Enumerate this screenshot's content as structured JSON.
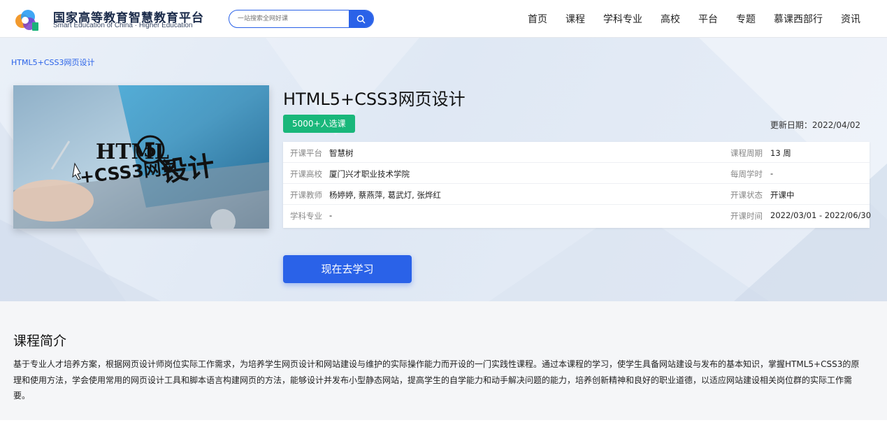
{
  "header": {
    "logo_title": "国家高等教育智慧教育平台",
    "logo_subtitle": "Smart Education of China · Higher Education",
    "search_placeholder": "一站搜索全网好课",
    "nav": [
      "首页",
      "课程",
      "学科专业",
      "高校",
      "平台",
      "专题",
      "慕课西部行",
      "资讯"
    ]
  },
  "breadcrumb": "HTML5+CSS3网页设计",
  "course": {
    "title": "HTML5+CSS3网页设计",
    "badge": "5000+人选课",
    "update_date": "更新日期：2022/04/02",
    "thumbnail_text": {
      "line1": "HTML",
      "circle": "5",
      "line2": "+CSS3网页",
      "big": "设计"
    },
    "info": [
      {
        "label": "开课平台",
        "value": "智慧树",
        "label_r": "课程周期",
        "value_r": "13 周"
      },
      {
        "label": "开课高校",
        "value": "厦门兴才职业技术学院",
        "label_r": "每周学时",
        "value_r": "-"
      },
      {
        "label": "开课教师",
        "value": "杨婷婷, 蔡燕萍, 葛武灯, 张烨红",
        "label_r": "开课状态",
        "value_r": "开课中"
      },
      {
        "label": "学科专业",
        "value": "-",
        "label_r": "开课时间",
        "value_r": "2022/03/01 - 2022/06/30"
      }
    ],
    "cta": "现在去学习"
  },
  "intro": {
    "title": "课程简介",
    "text": "基于专业人才培养方案，根据网页设计师岗位实际工作需求，为培养学生网页设计和网站建设与维护的实际操作能力而开设的一门实践性课程。通过本课程的学习，使学生具备网站建设与发布的基本知识，掌握HTML5+CSS3的原理和使用方法，学会使用常用的网页设计工具和脚本语言构建网页的方法，能够设计并发布小型静态网站，提高学生的自学能力和动手解决问题的能力，培养创新精神和良好的职业道德，以适应网站建设相关岗位群的实际工作需要。"
  },
  "colors": {
    "primary": "#2a62e8",
    "badge_green": "#19b77a",
    "hero_bg": "#e3ebf6"
  }
}
